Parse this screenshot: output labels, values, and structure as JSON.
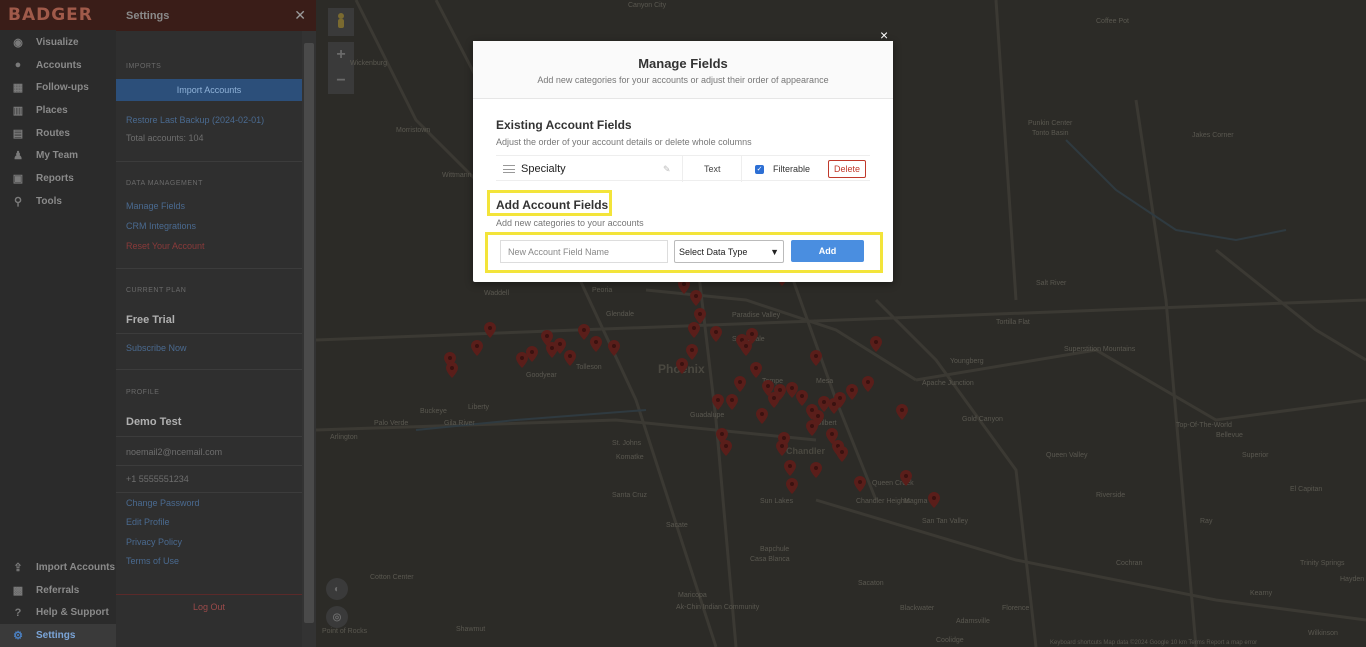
{
  "nav": {
    "logo": "BADGER",
    "items": [
      {
        "label": "Visualize",
        "icon": "eye-icon"
      },
      {
        "label": "Accounts",
        "icon": "user-circle-icon"
      },
      {
        "label": "Follow-ups",
        "icon": "calendar-icon"
      },
      {
        "label": "Places",
        "icon": "building-icon"
      },
      {
        "label": "Routes",
        "icon": "map-icon"
      },
      {
        "label": "My Team",
        "icon": "team-icon"
      },
      {
        "label": "Reports",
        "icon": "report-icon"
      },
      {
        "label": "Tools",
        "icon": "tools-icon"
      }
    ],
    "bottom": [
      {
        "label": "Import Accounts",
        "icon": "upload-icon"
      },
      {
        "label": "Referrals",
        "icon": "gift-icon"
      },
      {
        "label": "Help & Support",
        "icon": "help-icon"
      },
      {
        "label": "Settings",
        "icon": "gear-icon"
      }
    ]
  },
  "settings": {
    "title": "Settings",
    "imports_title": "IMPORTS",
    "import_btn": "Import Accounts",
    "restore": "Restore Last Backup (2024-02-01)",
    "total": "Total accounts: 104",
    "data_mgmt_title": "DATA MANAGEMENT",
    "manage_fields": "Manage Fields",
    "crm": "CRM Integrations",
    "reset": "Reset Your Account",
    "plan_title": "CURRENT PLAN",
    "plan": "Free Trial",
    "subscribe": "Subscribe Now",
    "profile_title": "PROFILE",
    "name": "Demo Test",
    "email": "noemail2@ncemail.com",
    "phone": "+1 5555551234",
    "change_pw": "Change Password",
    "edit_profile": "Edit Profile",
    "privacy": "Privacy Policy",
    "terms": "Terms of Use",
    "logout": "Log Out"
  },
  "map": {
    "labels": [
      "Canyon City",
      "Coffee Pot",
      "Wickenburg",
      "Morristown",
      "Wittmann",
      "Waddell",
      "Peoria",
      "Glendale",
      "Paradise Valley",
      "Scottsdale",
      "Phoenix",
      "Tolleson",
      "Goodyear",
      "Buckeye",
      "Liberty",
      "Palo Verde",
      "Arlington",
      "Gila River",
      "Guadalupe",
      "Tempe",
      "Mesa",
      "Gilbert",
      "Chandler",
      "St. Johns",
      "Komatke",
      "Santa Cruz",
      "Sacate",
      "Sun Lakes",
      "Queen Creek",
      "Chandler Heights",
      "Magma",
      "San Tan Valley",
      "Bapchule",
      "Casa Blanca",
      "Sacaton",
      "Maricopa",
      "Ak-Chin Indian Community",
      "Cotton Center",
      "Shawmut",
      "Point of Rocks",
      "Blackwater",
      "Florence",
      "Adamsville",
      "Coolidge",
      "Apache Junction",
      "Gold Canyon",
      "Youngberg",
      "Superstition Mountains",
      "Tortilla Flat",
      "Punkin Center",
      "Tonto Basin",
      "Jakes Corner",
      "Top-Of-The-World",
      "Bellevue",
      "Superior",
      "Queen Valley",
      "Kearny",
      "El Capitan",
      "Hayden",
      "Cochran",
      "Ray",
      "Riverside",
      "Trinity Springs",
      "Wilkinson",
      "Salt River"
    ],
    "city": "Phoenix",
    "zoom_in": "+",
    "zoom_out": "−",
    "attribution": "Keyboard shortcuts   Map data ©2024 Google   10 km   Terms   Report a map error"
  },
  "modal": {
    "close": "×",
    "title": "Manage Fields",
    "subtitle": "Add new categories for your accounts or adjust their order of appearance",
    "existing_title": "Existing Account Fields",
    "existing_sub": "Adjust the order of your account details or delete whole columns",
    "field": {
      "name": "Specialty",
      "type": "Text",
      "filter_label": "Filterable",
      "delete": "Delete"
    },
    "add_title": "Add Account Fields",
    "add_sub": "Add new categories to your accounts",
    "name_placeholder": "New Account Field Name",
    "type_select": "Select Data Type",
    "add_btn": "Add"
  }
}
